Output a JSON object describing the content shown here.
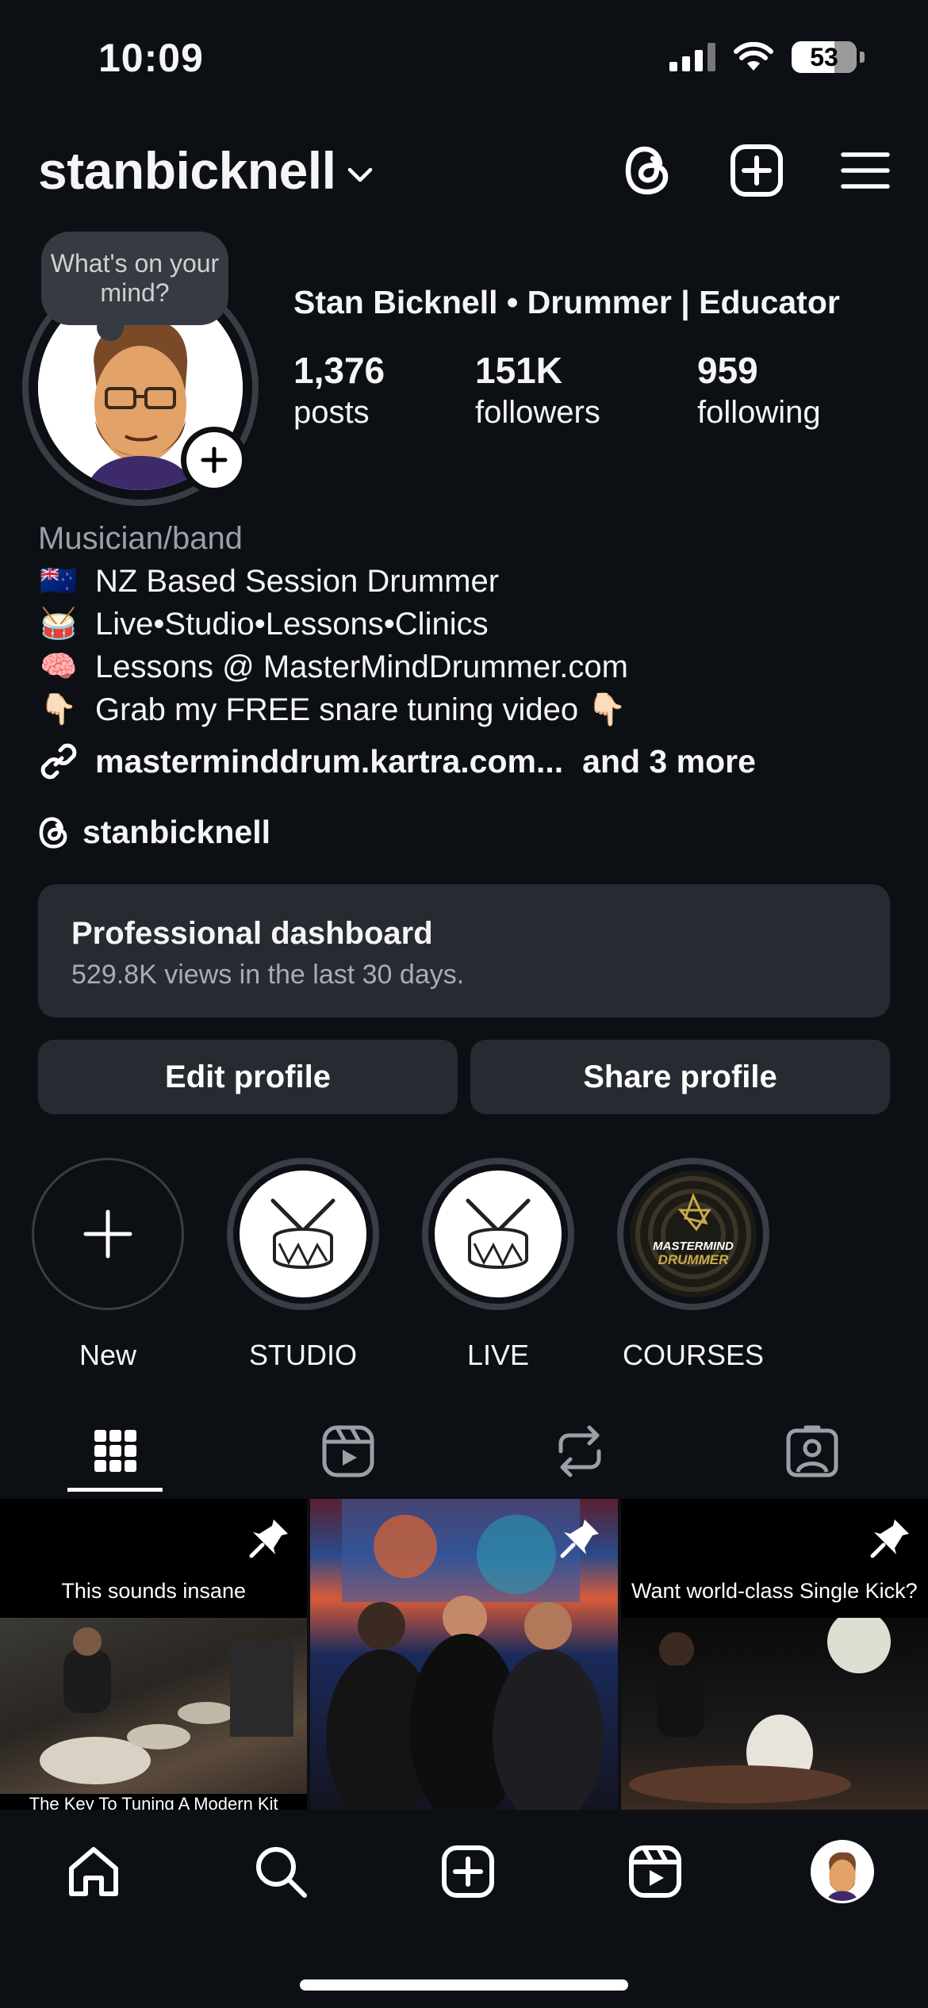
{
  "status_bar": {
    "time": "10:09",
    "battery": "53"
  },
  "header": {
    "username": "stanbicknell"
  },
  "profile": {
    "note": "What's on your mind?",
    "display_name": "Stan Bicknell • Drummer | Educator",
    "stats": [
      {
        "value": "1,376",
        "label": "posts"
      },
      {
        "value": "151K",
        "label": "followers"
      },
      {
        "value": "959",
        "label": "following"
      }
    ],
    "category": "Musician/band",
    "bio_lines": [
      {
        "emoji": "🇳🇿",
        "text": "NZ Based Session Drummer"
      },
      {
        "emoji": "🥁",
        "text": "Live•Studio•Lessons•Clinics"
      },
      {
        "emoji": "🧠",
        "text": "Lessons @ MasterMindDrummer.com"
      },
      {
        "emoji": "👇🏻",
        "text": "Grab my FREE snare tuning video 👇🏻"
      }
    ],
    "link": "masterminddrum.kartra.com...",
    "link_more": "and 3 more",
    "threads_handle": "stanbicknell"
  },
  "dashboard": {
    "title": "Professional dashboard",
    "subtitle": "529.8K views in the last 30 days."
  },
  "buttons": {
    "edit": "Edit profile",
    "share": "Share profile"
  },
  "highlights": [
    {
      "label": "New"
    },
    {
      "label": "STUDIO"
    },
    {
      "label": "LIVE"
    },
    {
      "label": "COURSES",
      "logo_text": "MASTERMIND DRUMMER"
    }
  ],
  "posts": [
    {
      "caption": "This sounds insane",
      "sub": "The Key To Tuning A Modern Kit"
    },
    {
      "caption": ""
    },
    {
      "caption": "Want world-class Single Kick?"
    }
  ],
  "colors": {
    "background": "#0c0f14",
    "card": "#262a31",
    "ring": "#3a3d45"
  }
}
